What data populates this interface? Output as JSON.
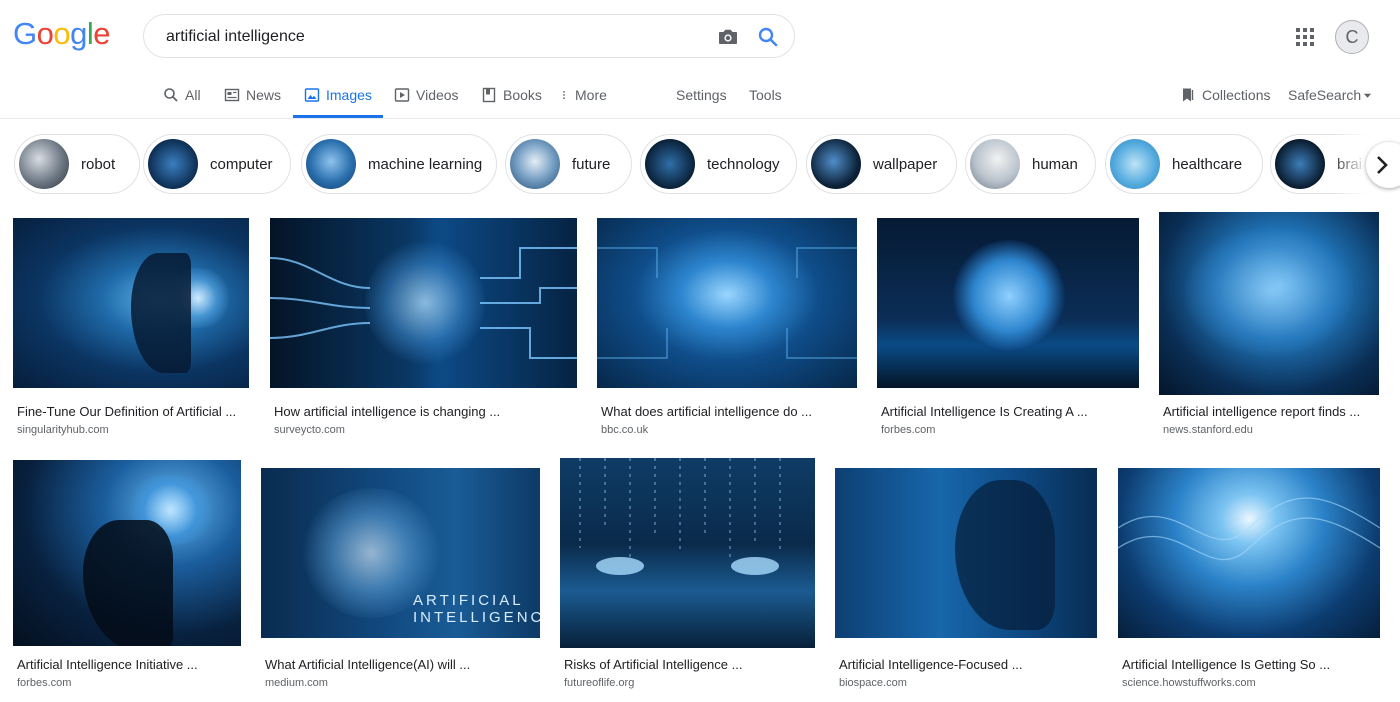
{
  "header": {
    "logo": "Google",
    "query": "artificial intelligence",
    "camera_icon": "camera-icon",
    "search_icon": "magnifier-icon",
    "apps_icon": "apps-grid-icon",
    "avatar_letter": "C"
  },
  "tabs": [
    {
      "label": "All",
      "icon": "search-icon"
    },
    {
      "label": "News",
      "icon": "news-icon"
    },
    {
      "label": "Images",
      "icon": "image-icon",
      "active": true
    },
    {
      "label": "Videos",
      "icon": "play-icon"
    },
    {
      "label": "Books",
      "icon": "book-icon"
    },
    {
      "label": "More",
      "icon": "kebab-icon"
    }
  ],
  "tools": {
    "settings": "Settings",
    "tools": "Tools",
    "collections": "Collections",
    "safesearch": "SafeSearch"
  },
  "chips": [
    {
      "label": "robot"
    },
    {
      "label": "computer"
    },
    {
      "label": "machine learning"
    },
    {
      "label": "future"
    },
    {
      "label": "technology"
    },
    {
      "label": "wallpaper"
    },
    {
      "label": "human"
    },
    {
      "label": "healthcare"
    },
    {
      "label": "brai"
    }
  ],
  "results": [
    {
      "title": "Fine-Tune Our Definition of Artificial ...",
      "source": "singularityhub.com"
    },
    {
      "title": "How artificial intelligence is changing ...",
      "source": "surveycto.com"
    },
    {
      "title": "What does artificial intelligence do ...",
      "source": "bbc.co.uk"
    },
    {
      "title": "Artificial Intelligence Is Creating A ...",
      "source": "forbes.com"
    },
    {
      "title": "Artificial intelligence report finds ...",
      "source": "news.stanford.edu"
    },
    {
      "title": "Artificial Intelligence Initiative ...",
      "source": "forbes.com"
    },
    {
      "title": "What Artificial Intelligence(AI) will ...",
      "source": "medium.com"
    },
    {
      "title": "Risks of Artificial Intelligence ...",
      "source": "futureoflife.org"
    },
    {
      "title": "Artificial Intelligence-Focused ...",
      "source": "biospace.com"
    },
    {
      "title": "Artificial Intelligence Is Getting So ...",
      "source": "science.howstuffworks.com"
    }
  ],
  "image_text": {
    "line1": "ARTIFICIAL",
    "line2": "INTELLIGENCE"
  },
  "colors": {
    "accent": "#1a73e8",
    "g_blue": "#4285f4",
    "g_red": "#ea4335",
    "g_yellow": "#fbbc05",
    "g_green": "#34a853"
  }
}
